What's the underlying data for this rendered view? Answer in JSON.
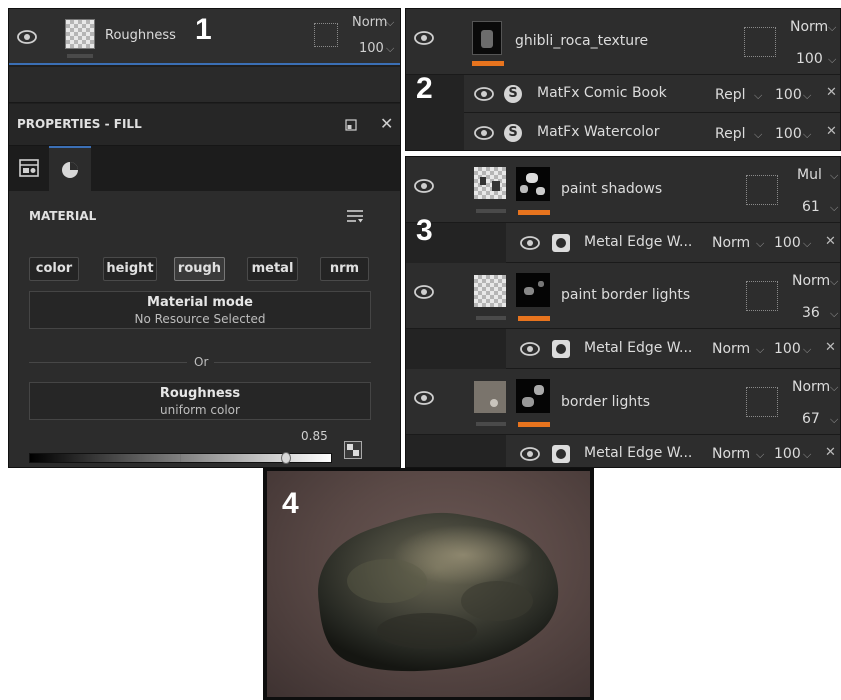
{
  "panel1": {
    "label": "1",
    "layer": {
      "name": "Roughness",
      "blend": "Norm",
      "opacity": "100"
    },
    "properties_title": "PROPERTIES - FILL",
    "material_section": "MATERIAL",
    "channels": [
      "color",
      "height",
      "rough",
      "metal",
      "nrm"
    ],
    "active_channel": "rough",
    "material_mode": {
      "title": "Material mode",
      "value": "No Resource Selected"
    },
    "or_label": "Or",
    "roughness": {
      "title": "Roughness",
      "value": "uniform color"
    },
    "slider_value": "0.85",
    "slider_fraction": 0.85
  },
  "panel2": {
    "label": "2",
    "layer": {
      "name": "ghibli_roca_texture",
      "blend": "Norm",
      "opacity": "100"
    },
    "effects": [
      {
        "name": "MatFx Comic Book",
        "blend": "Repl",
        "opacity": "100"
      },
      {
        "name": "MatFx Watercolor",
        "blend": "Repl",
        "opacity": "100"
      }
    ]
  },
  "panel3": {
    "label": "3",
    "layers": [
      {
        "name": "paint shadows",
        "blend": "Mul",
        "opacity": "61",
        "sub": {
          "name": "Metal Edge W...",
          "blend": "Norm",
          "opacity": "100"
        }
      },
      {
        "name": "paint border lights",
        "blend": "Norm",
        "opacity": "36",
        "sub": {
          "name": "Metal Edge W...",
          "blend": "Norm",
          "opacity": "100"
        }
      },
      {
        "name": "border lights",
        "blend": "Norm",
        "opacity": "67",
        "sub": {
          "name": "Metal Edge W...",
          "blend": "Norm",
          "opacity": "100"
        }
      }
    ]
  },
  "panel4": {
    "label": "4"
  },
  "colors": {
    "accent": "#e8741e",
    "selection": "#3b6fb5",
    "panel": "#2d2d2d"
  },
  "icons": [
    "eye-icon",
    "substance-icon",
    "mask-icon",
    "close-icon",
    "popout-icon",
    "list-icon",
    "swatch-icon",
    "chevron-down-icon"
  ]
}
